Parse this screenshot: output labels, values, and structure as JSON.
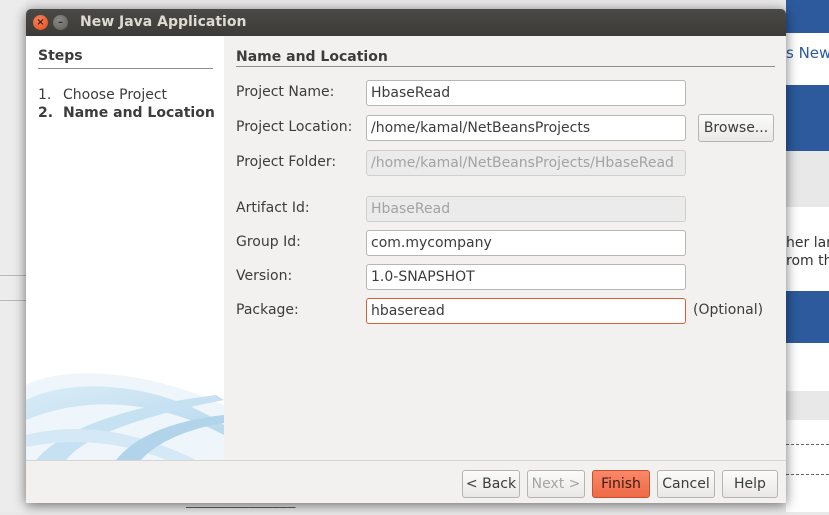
{
  "background": {
    "right_snippet_1": "s New",
    "right_snippet_2": "her lar",
    "right_snippet_3": "rom th",
    "bottom_snippet": "——————————————"
  },
  "dialog": {
    "title": "New Java Application",
    "close_icon": "×",
    "minimize_icon": "–",
    "steps": {
      "heading": "Steps",
      "items": [
        {
          "num": "1.",
          "label": "Choose Project"
        },
        {
          "num": "2.",
          "label": "Name and Location"
        }
      ]
    },
    "section_title": "Name and Location",
    "fields": {
      "project_name": {
        "label": "Project Name:",
        "value": "HbaseRead"
      },
      "project_location": {
        "label": "Project Location:",
        "value": "/home/kamal/NetBeansProjects"
      },
      "project_folder": {
        "label": "Project Folder:",
        "value": "/home/kamal/NetBeansProjects/HbaseRead"
      },
      "artifact_id": {
        "label": "Artifact Id:",
        "value": "HbaseRead"
      },
      "group_id": {
        "label": "Group Id:",
        "value": "com.mycompany"
      },
      "version": {
        "label": "Version:",
        "value": "1.0-SNAPSHOT"
      },
      "package": {
        "label": "Package:",
        "value": "hbaseread"
      }
    },
    "browse_label": "Browse...",
    "optional_label": "(Optional)",
    "buttons": {
      "back": "< Back",
      "next": "Next >",
      "finish": "Finish",
      "cancel": "Cancel",
      "help": "Help"
    }
  },
  "colors": {
    "accent": "#ee6a45",
    "titlebar": "#3c3b37",
    "ide_blue": "#2c5a9c"
  }
}
